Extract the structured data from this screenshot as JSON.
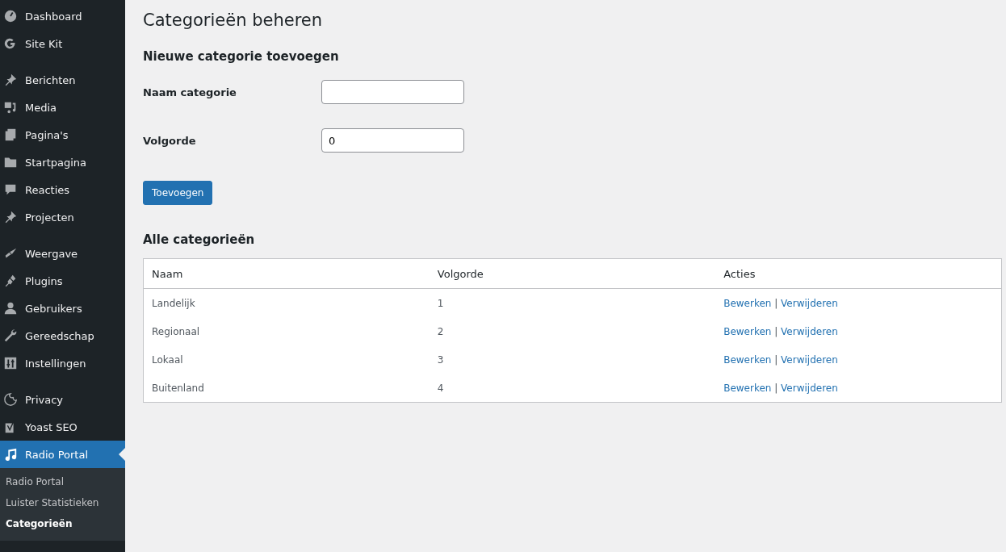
{
  "sidebar": {
    "groups": [
      {
        "items": [
          {
            "label": "Dashboard",
            "current": false
          },
          {
            "label": "Site Kit",
            "current": false
          }
        ]
      },
      {
        "items": [
          {
            "label": "Berichten",
            "current": false
          },
          {
            "label": "Media",
            "current": false
          },
          {
            "label": "Pagina's",
            "current": false
          },
          {
            "label": "Startpagina",
            "current": false
          },
          {
            "label": "Reacties",
            "current": false
          },
          {
            "label": "Projecten",
            "current": false
          }
        ]
      },
      {
        "items": [
          {
            "label": "Weergave",
            "current": false
          },
          {
            "label": "Plugins",
            "current": false
          },
          {
            "label": "Gebruikers",
            "current": false
          },
          {
            "label": "Gereedschap",
            "current": false
          },
          {
            "label": "Instellingen",
            "current": false
          }
        ]
      },
      {
        "items": [
          {
            "label": "Privacy",
            "current": false
          },
          {
            "label": "Yoast SEO",
            "current": false
          },
          {
            "label": "Radio Portal",
            "current": true,
            "submenu": [
              {
                "label": "Radio Portal",
                "selected": false
              },
              {
                "label": "Luister Statistieken",
                "selected": false
              },
              {
                "label": "Categorieën",
                "selected": true
              }
            ]
          }
        ]
      }
    ]
  },
  "page_title": "Categorieën beheren",
  "form": {
    "heading": "Nieuwe categorie toevoegen",
    "fields": [
      {
        "label": "Naam categorie"
      },
      {
        "label": "Volgorde",
        "value": "0"
      }
    ],
    "submit": "Toevoegen"
  },
  "table": {
    "heading": "Alle categorieën",
    "columns": [
      "Naam",
      "Volgorde",
      "Acties"
    ],
    "rows": [
      {
        "name": "Landelijk",
        "order": "1",
        "actions": [
          "Bewerken",
          "Verwijderen"
        ]
      },
      {
        "name": "Regionaal",
        "order": "2",
        "actions": [
          "Bewerken",
          "Verwijderen"
        ]
      },
      {
        "name": "Lokaal",
        "order": "3",
        "actions": [
          "Bewerken",
          "Verwijderen"
        ]
      },
      {
        "name": "Buitenland",
        "order": "4",
        "actions": [
          "Bewerken",
          "Verwijderen"
        ]
      }
    ],
    "separator": "|"
  }
}
